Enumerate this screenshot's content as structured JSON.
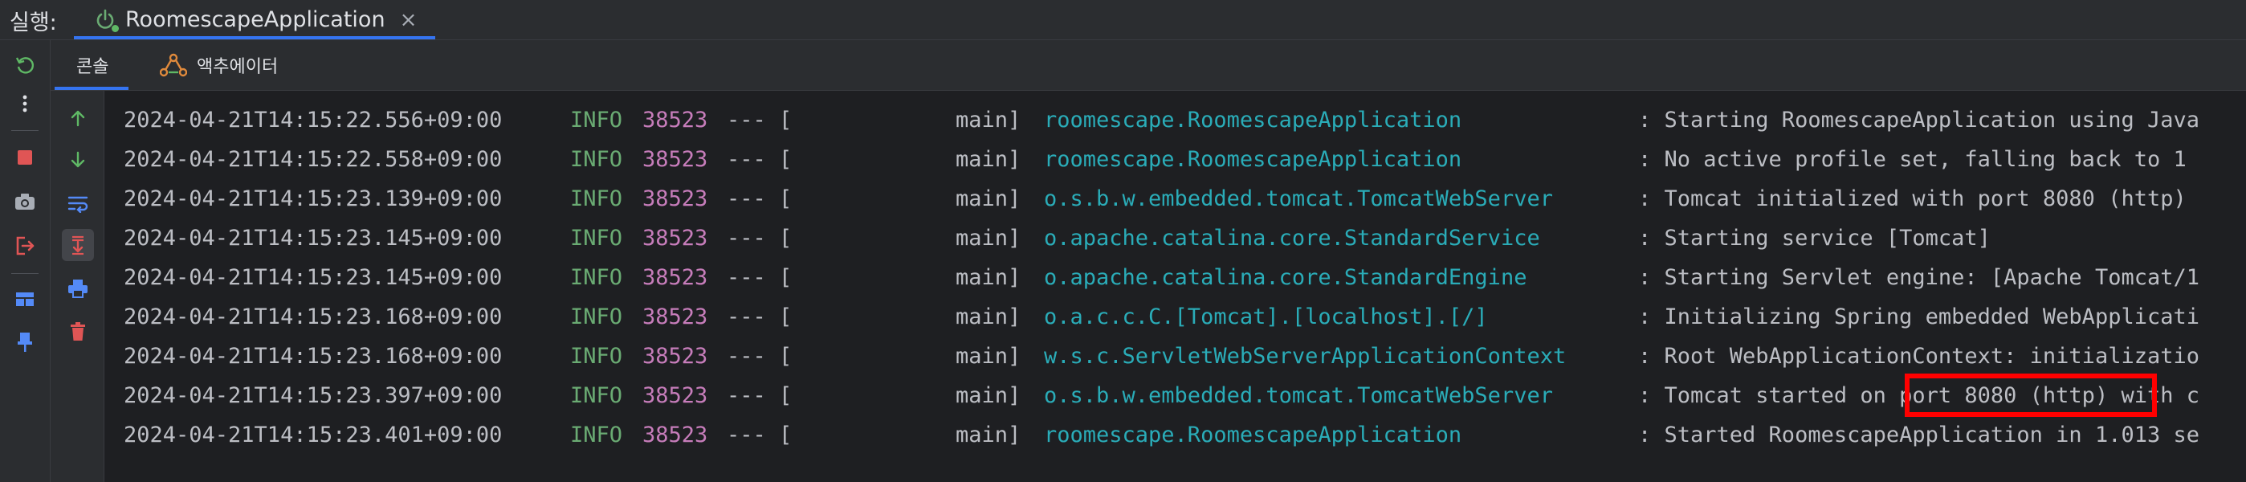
{
  "runbar": {
    "label": "실행:",
    "tab_title": "RoomescapeApplication",
    "close_glyph": "×"
  },
  "left_toolbar": {
    "icons": [
      "rerun-icon",
      "more-options-icon",
      "stop-icon",
      "camera-icon",
      "exit-icon",
      "layout-icon",
      "pin-icon"
    ]
  },
  "subtabs": {
    "console_label": "콘솔",
    "actuator_label": "액추에이터"
  },
  "console_toolbar": {
    "icons": [
      "scroll-up-icon",
      "scroll-down-icon",
      "soft-wrap-icon",
      "scroll-to-end-icon",
      "print-icon",
      "clear-icon"
    ]
  },
  "log": {
    "rows": [
      {
        "ts": "2024-04-21T14:15:22.556+09:00",
        "level": "INFO",
        "pid": "38523",
        "sep": "--- [",
        "thread": "main]",
        "logger": "roomescape.RoomescapeApplication",
        "msg": ": Starting RoomescapeApplication using Java"
      },
      {
        "ts": "2024-04-21T14:15:22.558+09:00",
        "level": "INFO",
        "pid": "38523",
        "sep": "--- [",
        "thread": "main]",
        "logger": "roomescape.RoomescapeApplication",
        "msg": ": No active profile set, falling back to 1"
      },
      {
        "ts": "2024-04-21T14:15:23.139+09:00",
        "level": "INFO",
        "pid": "38523",
        "sep": "--- [",
        "thread": "main]",
        "logger": "o.s.b.w.embedded.tomcat.TomcatWebServer",
        "msg": ": Tomcat initialized with port 8080 (http)"
      },
      {
        "ts": "2024-04-21T14:15:23.145+09:00",
        "level": "INFO",
        "pid": "38523",
        "sep": "--- [",
        "thread": "main]",
        "logger": "o.apache.catalina.core.StandardService",
        "msg": ": Starting service [Tomcat]"
      },
      {
        "ts": "2024-04-21T14:15:23.145+09:00",
        "level": "INFO",
        "pid": "38523",
        "sep": "--- [",
        "thread": "main]",
        "logger": "o.apache.catalina.core.StandardEngine",
        "msg": ": Starting Servlet engine: [Apache Tomcat/1"
      },
      {
        "ts": "2024-04-21T14:15:23.168+09:00",
        "level": "INFO",
        "pid": "38523",
        "sep": "--- [",
        "thread": "main]",
        "logger": "o.a.c.c.C.[Tomcat].[localhost].[/]",
        "msg": ": Initializing Spring embedded WebApplicati"
      },
      {
        "ts": "2024-04-21T14:15:23.168+09:00",
        "level": "INFO",
        "pid": "38523",
        "sep": "--- [",
        "thread": "main]",
        "logger": "w.s.c.ServletWebServerApplicationContext",
        "msg": ": Root WebApplicationContext: initializatio"
      },
      {
        "ts": "2024-04-21T14:15:23.397+09:00",
        "level": "INFO",
        "pid": "38523",
        "sep": "--- [",
        "thread": "main]",
        "logger": "o.s.b.w.embedded.tomcat.TomcatWebServer",
        "msg": ": Tomcat started on port 8080 (http) with c"
      },
      {
        "ts": "2024-04-21T14:15:23.401+09:00",
        "level": "INFO",
        "pid": "38523",
        "sep": "--- [",
        "thread": "main]",
        "logger": "roomescape.RoomescapeApplication",
        "msg": ": Started RoomescapeApplication in 1.013 se"
      }
    ]
  },
  "colors": {
    "accent": "#3574f0",
    "info": "#6aab73",
    "pid": "#c77dbb",
    "logger": "#2aacb8",
    "highlight": "#ff0000"
  }
}
